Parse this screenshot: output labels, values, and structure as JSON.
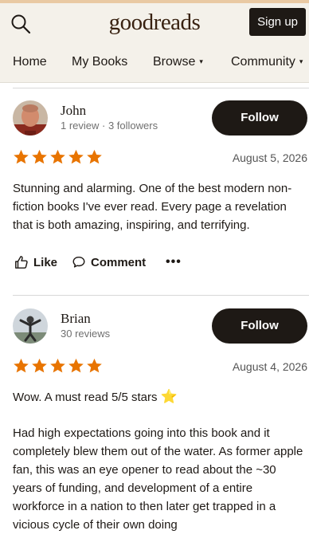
{
  "header": {
    "logo": "goodreads",
    "signup_label": "Sign up"
  },
  "nav": {
    "items": [
      {
        "label": "Home",
        "has_caret": false
      },
      {
        "label": "My Books",
        "has_caret": false
      },
      {
        "label": "Browse",
        "has_caret": true
      },
      {
        "label": "Community",
        "has_caret": true
      }
    ],
    "caret": "▾"
  },
  "reviews": [
    {
      "name": "John",
      "meta": "1 review · 3 followers",
      "follow_label": "Follow",
      "rating": 5,
      "date": "August 5, 2026",
      "paragraphs": [
        "Stunning and alarming. One of the best modern non-fiction books I've ever read. Every page a revelation that is both amazing, inspiring, and terrifying."
      ],
      "actions": {
        "like": "Like",
        "comment": "Comment",
        "more": "•••"
      }
    },
    {
      "name": "Brian",
      "meta": "30 reviews",
      "follow_label": "Follow",
      "rating": 5,
      "date": "August 4, 2026",
      "paragraphs": [
        "Wow. A must read 5/5 stars",
        "Had high expectations going into this book and it completely blew them out of the water. As former apple fan, this was an eye opener to read about the ~30 years of funding, and development of a entire workforce in a nation to then later get trapped in a vicious cycle of their own doing"
      ],
      "emoji": "⭐"
    }
  ],
  "colors": {
    "star": "#e87400",
    "button": "#1e1915",
    "header_bg": "#f4f1ea"
  }
}
